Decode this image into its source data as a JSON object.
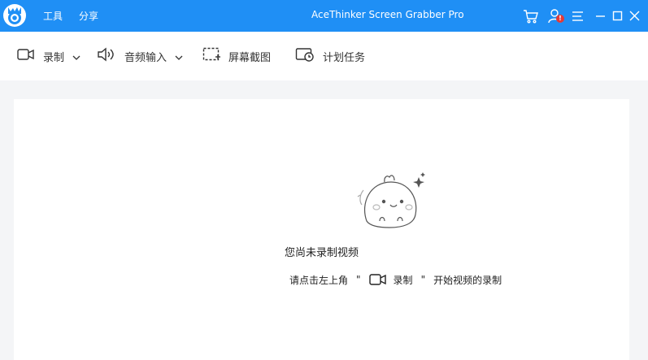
{
  "app": {
    "title": "AceThinker Screen Grabber Pro",
    "menu": [
      {
        "id": "tools",
        "label": "工具"
      },
      {
        "id": "share",
        "label": "分享"
      }
    ],
    "window_icons": [
      "cart-icon",
      "user-account-icon",
      "menu-icon",
      "minimize-icon",
      "maximize-icon",
      "close-icon"
    ],
    "notification_badge": "!",
    "accent_color": "#1f8ff5",
    "badge_color": "#e53935"
  },
  "toolbar": {
    "record_label": "录制",
    "audio_label": "音频输入",
    "screenshot_label": "屏幕截图",
    "schedule_label": "计划任务"
  },
  "empty_state": {
    "title": "您尚未录制视频",
    "hint_prefix": "请点击左上角",
    "open_quote": "\"",
    "record_label": "录制",
    "close_quote": "\"",
    "hint_suffix": "开始视频的录制"
  }
}
